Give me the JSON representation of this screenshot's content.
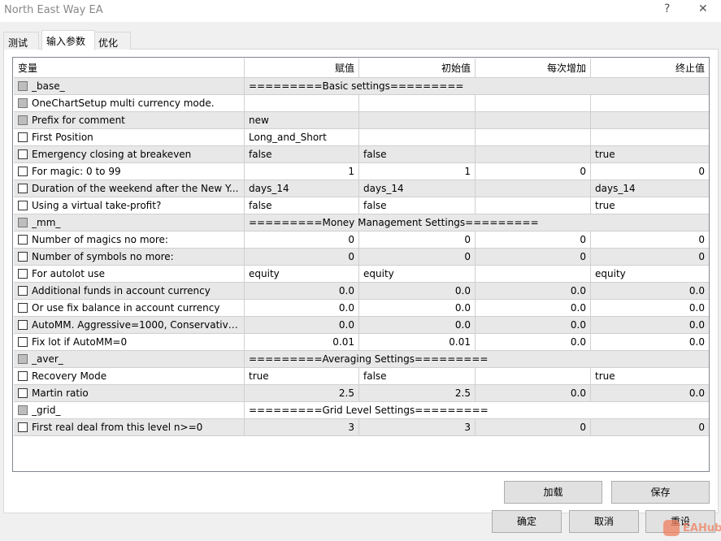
{
  "window": {
    "title": "North East Way EA",
    "help": "?",
    "close": "✕"
  },
  "tabs": [
    {
      "label": "测试"
    },
    {
      "label": "输入参数",
      "active": true
    },
    {
      "label": "优化"
    }
  ],
  "columns": [
    "变量",
    "赋值",
    "初始值",
    "每次增加",
    "终止值"
  ],
  "rows": [
    {
      "name": "_base_",
      "disabled": true,
      "group": true,
      "value": "=========Basic settings========="
    },
    {
      "name": "OneChartSetup multi currency mode.",
      "disabled": true,
      "value": "",
      "start": "",
      "step": "",
      "stop": ""
    },
    {
      "name": "Prefix for comment",
      "disabled": true,
      "value": "new",
      "start": "",
      "step": "",
      "stop": ""
    },
    {
      "name": "First Position",
      "value": "Long_and_Short",
      "start": "",
      "step": "",
      "stop": ""
    },
    {
      "name": "Emergency closing at breakeven",
      "value": "false",
      "start": "false",
      "step": "",
      "stop": "true"
    },
    {
      "name": "For magic: 0 to 99",
      "num": true,
      "value": "1",
      "start": "1",
      "step": "0",
      "stop": "0"
    },
    {
      "name": "Duration of the weekend after the New Y...",
      "value": "days_14",
      "start": "days_14",
      "step": "",
      "stop": "days_14"
    },
    {
      "name": "Using a virtual take-profit?",
      "value": "false",
      "start": "false",
      "step": "",
      "stop": "true"
    },
    {
      "name": "_mm_",
      "disabled": true,
      "group": true,
      "value": "=========Money Management Settings========="
    },
    {
      "name": "Number of magics no more:",
      "num": true,
      "value": "0",
      "start": "0",
      "step": "0",
      "stop": "0"
    },
    {
      "name": "Number of symbols no more:",
      "num": true,
      "value": "0",
      "start": "0",
      "step": "0",
      "stop": "0"
    },
    {
      "name": "For autolot use",
      "value": "equity",
      "start": "equity",
      "step": "",
      "stop": "equity"
    },
    {
      "name": "Additional funds in account currency",
      "num": true,
      "value": "0.0",
      "start": "0.0",
      "step": "0.0",
      "stop": "0.0"
    },
    {
      "name": "Or use fix balance in account currency",
      "num": true,
      "value": "0.0",
      "start": "0.0",
      "step": "0.0",
      "stop": "0.0"
    },
    {
      "name": "AutoMM. Aggressive=1000, Conservative...",
      "num": true,
      "value": "0.0",
      "start": "0.0",
      "step": "0.0",
      "stop": "0.0"
    },
    {
      "name": "Fix lot if AutoMM=0",
      "num": true,
      "value": "0.01",
      "start": "0.01",
      "step": "0.0",
      "stop": "0.0"
    },
    {
      "name": "_aver_",
      "disabled": true,
      "group": true,
      "value": "=========Averaging Settings========="
    },
    {
      "name": "Recovery Mode",
      "value": "true",
      "start": "false",
      "step": "",
      "stop": "true"
    },
    {
      "name": "Martin ratio",
      "num": true,
      "value": "2.5",
      "start": "2.5",
      "step": "0.0",
      "stop": "0.0"
    },
    {
      "name": "_grid_",
      "disabled": true,
      "group": true,
      "value": "=========Grid Level Settings========="
    },
    {
      "name": "First real deal from this level n>=0",
      "num": true,
      "value": "3",
      "start": "3",
      "step": "0",
      "stop": "0"
    }
  ],
  "buttons": {
    "load": "加载",
    "save": "保存",
    "ok": "确定",
    "cancel": "取消",
    "reset": "重设"
  },
  "watermark": "EAHub"
}
